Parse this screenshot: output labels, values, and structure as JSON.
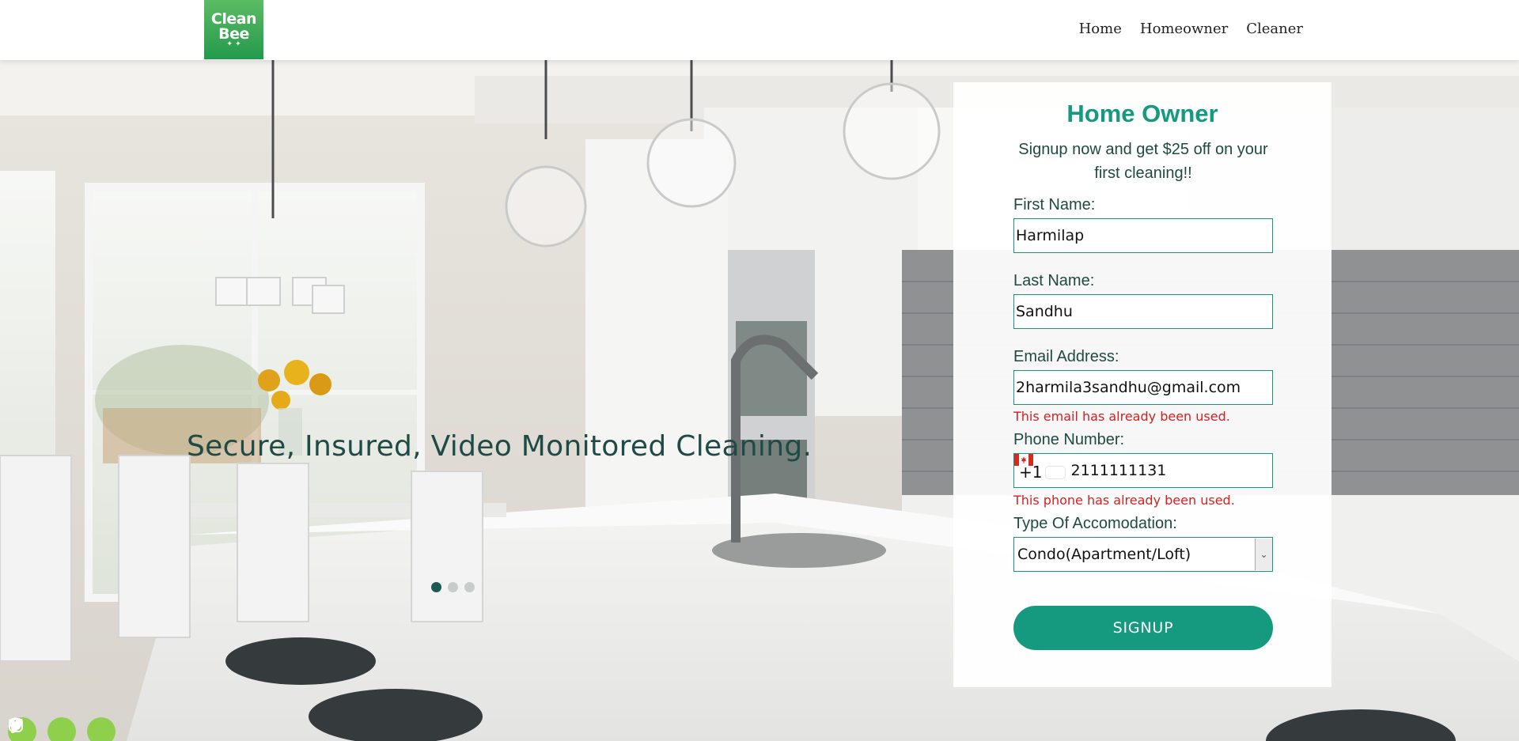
{
  "logo": {
    "line1": "Clean",
    "line2": "Bee",
    "sparkle": "✦ ✦",
    "brand_color": "#2a9d4f"
  },
  "nav": [
    {
      "label": "Home"
    },
    {
      "label": "Homeowner"
    },
    {
      "label": "Cleaner"
    }
  ],
  "hero": {
    "tagline": "Secure, Insured, Video Monitored Cleaning.",
    "slider": {
      "total": 3,
      "active": 1
    }
  },
  "social": [
    {
      "icon": "instagram-icon"
    },
    {
      "icon": "twitter-icon"
    },
    {
      "icon": "facebook-icon"
    }
  ],
  "form": {
    "title": "Home Owner",
    "promo": "Signup now and get $25 off on your first cleaning!!",
    "first_name": {
      "label": "First Name:",
      "value": "Harmilap"
    },
    "last_name": {
      "label": "Last Name:",
      "value": "Sandhu"
    },
    "email": {
      "label": "Email Address:",
      "value": "2harmila3sandhu@gmail.com",
      "error": "This email has already been used."
    },
    "phone": {
      "label": "Phone Number:",
      "prefix": "+1",
      "flag": "canada-flag-icon",
      "value": "2111111131",
      "error": "This phone has already been used."
    },
    "accommodation": {
      "label": "Type Of Accomodation:",
      "selected": "Condo(Apartment/Loft)"
    },
    "submit_label": "SIGNUP",
    "accent_color": "#159a80",
    "error_color": "#d62020"
  }
}
